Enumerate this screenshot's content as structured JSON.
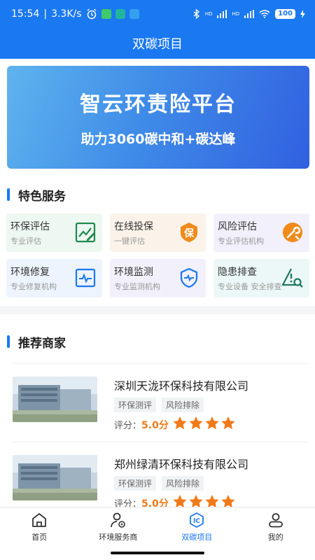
{
  "status": {
    "time": "15:54",
    "speed": "3.3K/s",
    "battery": "100",
    "icons": [
      "alarm-icon",
      "app-icon-green",
      "app-icon-teal",
      "app-icon-blue",
      "bluetooth-icon",
      "signal-icon",
      "signal-icon",
      "wifi-icon",
      "battery-icon",
      "charging-icon"
    ],
    "net_labels": [
      "HD",
      "HD"
    ]
  },
  "header": {
    "title": "双碳项目"
  },
  "banner": {
    "title": "智云环责险平台",
    "subtitle": "助力3060碳中和+碳达峰"
  },
  "features": {
    "title": "特色服务",
    "items": [
      {
        "name": "环保评估",
        "sub": "专业评估",
        "icon": "chart-pencil-icon",
        "color": "#1f8a4c"
      },
      {
        "name": "在线投保",
        "sub": "一键评估",
        "icon": "insure-badge-icon",
        "color": "#f08a1a",
        "glyph": "保"
      },
      {
        "name": "风险评估",
        "sub": "专业评估机构",
        "icon": "wrench-gear-icon",
        "color": "#f08a1a"
      },
      {
        "name": "环境修复",
        "sub": "专业修复机构",
        "icon": "pulse-monitor-icon",
        "color": "#1a78f0"
      },
      {
        "name": "环境监测",
        "sub": "专业监测机构",
        "icon": "shield-pulse-icon",
        "color": "#1a78f0"
      },
      {
        "name": "隐患排查",
        "sub": "专业设备 安全排查",
        "icon": "warning-search-icon",
        "color": "#1f7a5c"
      }
    ]
  },
  "recommend": {
    "title": "推荐商家",
    "merchants": [
      {
        "name": "深圳天泷环保科技有限公司",
        "tags": [
          "环保测评",
          "风险排除"
        ],
        "rating_label": "评分：",
        "score": "5.0分",
        "stars": 4
      },
      {
        "name": "郑州绿清环保科技有限公司",
        "tags": [
          "环保测评",
          "风险排除"
        ],
        "rating_label": "评分：",
        "score": "5.0分",
        "stars": 4
      }
    ]
  },
  "tabs": [
    {
      "label": "首页",
      "icon": "home-icon",
      "active": false
    },
    {
      "label": "环境服务商",
      "icon": "user-service-icon",
      "active": false
    },
    {
      "label": "双碳项目",
      "icon": "carbon-project-icon",
      "active": true
    },
    {
      "label": "我的",
      "icon": "profile-icon",
      "active": false
    }
  ],
  "colors": {
    "primary": "#1a78f0",
    "accent": "#f07a1a"
  }
}
